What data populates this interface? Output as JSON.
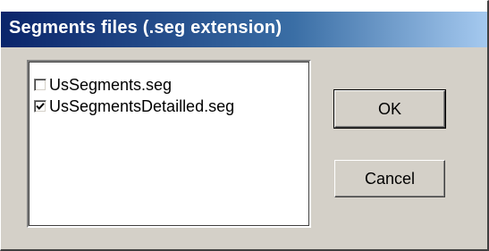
{
  "window": {
    "title": "Segments files (.seg extension)"
  },
  "files_list": {
    "items": [
      {
        "label": "UsSegments.seg",
        "checked": false
      },
      {
        "label": "UsSegmentsDetailled.seg",
        "checked": true
      }
    ]
  },
  "buttons": {
    "ok_label": "OK",
    "cancel_label": "Cancel"
  },
  "colors": {
    "title_bar_start": "#0a246a",
    "title_bar_end": "#a6caf0",
    "dialog_face": "#d4d0c8"
  }
}
